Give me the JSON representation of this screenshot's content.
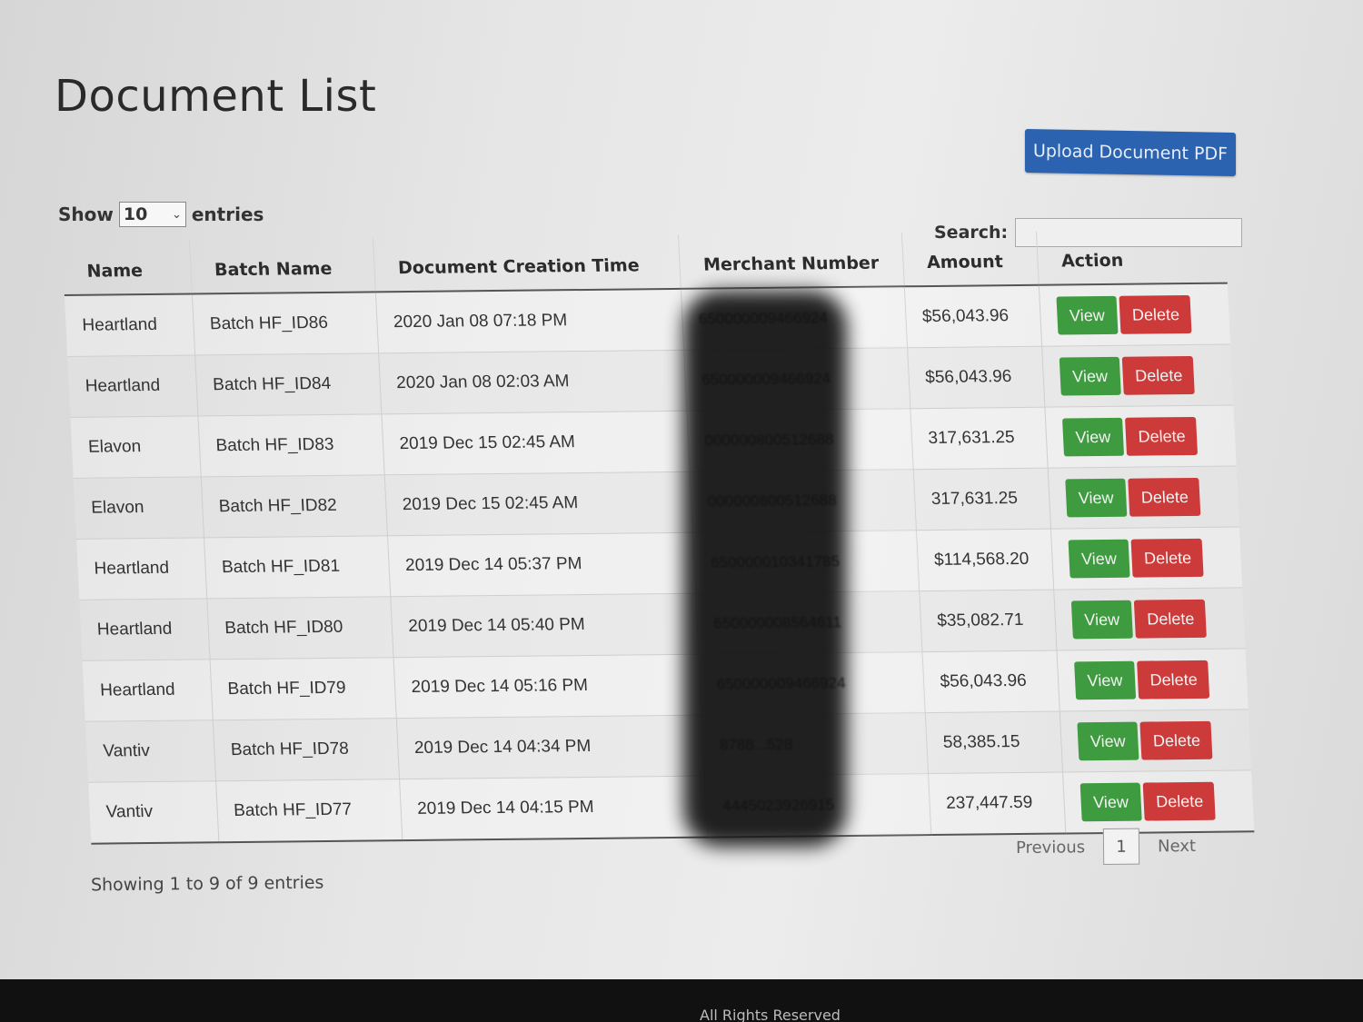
{
  "page_title": "Document List",
  "upload_button": "Upload Document PDF",
  "length_menu": {
    "show": "Show",
    "value": "10",
    "entries": "entries"
  },
  "search": {
    "label": "Search:",
    "value": ""
  },
  "columns": [
    "Name",
    "Batch Name",
    "Document Creation Time",
    "Merchant Number",
    "Amount",
    "Action"
  ],
  "rows": [
    {
      "name": "Heartland",
      "batch": "Batch HF_ID86",
      "time": "2020 Jan 08 07:18 PM",
      "merchant": "650000009466924",
      "amount": "$56,043.96"
    },
    {
      "name": "Heartland",
      "batch": "Batch HF_ID84",
      "time": "2020 Jan 08 02:03 AM",
      "merchant": "650000009466924",
      "amount": "$56,043.96"
    },
    {
      "name": "Elavon",
      "batch": "Batch HF_ID83",
      "time": "2019 Dec 15 02:45 AM",
      "merchant": "000000800512688",
      "amount": "317,631.25"
    },
    {
      "name": "Elavon",
      "batch": "Batch HF_ID82",
      "time": "2019 Dec 15 02:45 AM",
      "merchant": "000000800512688",
      "amount": "317,631.25"
    },
    {
      "name": "Heartland",
      "batch": "Batch HF_ID81",
      "time": "2019 Dec 14 05:37 PM",
      "merchant": "650000010341785",
      "amount": "$114,568.20"
    },
    {
      "name": "Heartland",
      "batch": "Batch HF_ID80",
      "time": "2019 Dec 14 05:40 PM",
      "merchant": "650000008564611",
      "amount": "$35,082.71"
    },
    {
      "name": "Heartland",
      "batch": "Batch HF_ID79",
      "time": "2019 Dec 14 05:16 PM",
      "merchant": "650000009466924",
      "amount": "$56,043.96"
    },
    {
      "name": "Vantiv",
      "batch": "Batch HF_ID78",
      "time": "2019 Dec 14 04:34 PM",
      "merchant": "8788...528",
      "amount": "58,385.15"
    },
    {
      "name": "Vantiv",
      "batch": "Batch HF_ID77",
      "time": "2019 Dec 14 04:15 PM",
      "merchant": "4445023926915",
      "amount": "237,447.59"
    }
  ],
  "actions": {
    "view": "View",
    "delete": "Delete"
  },
  "info": "Showing 1 to 9 of 9 entries",
  "pagination": {
    "previous": "Previous",
    "page": "1",
    "next": "Next"
  },
  "footer": "All Rights Reserved",
  "colors": {
    "primary": "#2b63b0",
    "view": "#3f9b3f",
    "delete": "#cc3a3a"
  }
}
